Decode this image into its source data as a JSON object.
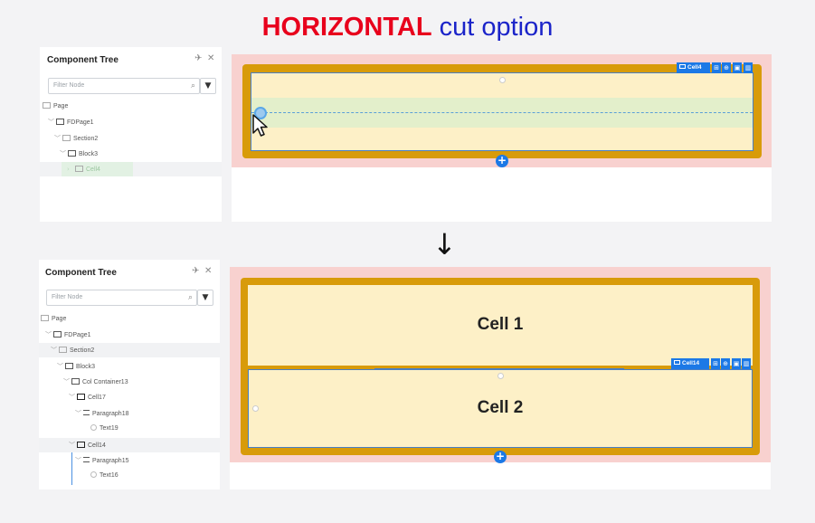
{
  "heading": {
    "keyword": "HORIZONTAL",
    "rest": " cut option"
  },
  "arrow_glyph": "↓",
  "top": {
    "panel": {
      "title": "Component Tree",
      "pin_icon": "✈",
      "close_icon": "✕",
      "filter_placeholder": "Filter Node",
      "tree": [
        {
          "label": "Page"
        },
        {
          "label": "FDPage1"
        },
        {
          "label": "Section2"
        },
        {
          "label": "Block3"
        },
        {
          "label": "Cell4"
        }
      ]
    },
    "selected_badge": "Cell4"
  },
  "bottom": {
    "panel": {
      "title": "Component Tree",
      "pin_icon": "✈",
      "close_icon": "✕",
      "filter_placeholder": "Filter Node",
      "tree": [
        {
          "label": "Page"
        },
        {
          "label": "FDPage1"
        },
        {
          "label": "Section2"
        },
        {
          "label": "Block3"
        },
        {
          "label": "Col Container13"
        },
        {
          "label": "Cell17"
        },
        {
          "label": "Paragraph18"
        },
        {
          "label": "Text19"
        },
        {
          "label": "Cell14"
        },
        {
          "label": "Paragraph15"
        },
        {
          "label": "Text16"
        }
      ]
    },
    "cell1_label": "Cell 1",
    "cell2_label": "Cell 2",
    "selected_badge": "Cell14"
  },
  "colors": {
    "keyword": "#e8001c",
    "rest": "#1b24c9",
    "accent_blue": "#1c79e6",
    "gold_border": "#d89b0a",
    "cell_fill": "#fdf0c7",
    "pink_section": "#f8d1cf"
  },
  "icons": [
    "pin-icon",
    "close-icon",
    "search-icon",
    "filter-icon",
    "plus-icon",
    "cursor-icon",
    "split-handle-icon",
    "toolbar-icons"
  ]
}
